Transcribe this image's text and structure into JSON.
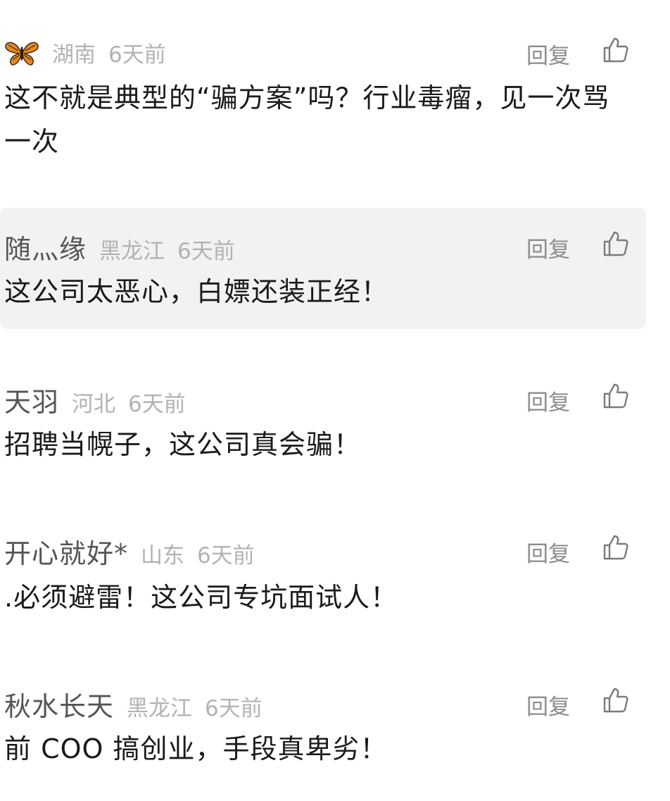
{
  "comments": [
    {
      "name": "",
      "location": "湖南",
      "time": "6天前",
      "text": "这不就是典型的“骗方案”吗？行业毒瘤，见一次骂一次",
      "reply_label": "回复",
      "avatar_icon": "butterfly-icon"
    },
    {
      "name": "随灬缘",
      "location": "黑龙江",
      "time": "6天前",
      "text": "这公司太恶心，白嫖还装正经！",
      "reply_label": "回复"
    },
    {
      "name": "天羽",
      "location": "河北",
      "time": "6天前",
      "text": "招聘当幌子，这公司真会骗！",
      "reply_label": "回复"
    },
    {
      "name": "开心就好*",
      "location": "山东",
      "time": "6天前",
      "text": ".必须避雷！这公司专坑面试人！",
      "reply_label": "回复"
    },
    {
      "name": "秋水长天",
      "location": "黑龙江",
      "time": "6天前",
      "text": "前 COO 搞创业，手段真卑劣！",
      "reply_label": "回复"
    }
  ],
  "colors": {
    "highlight_bg": "#f2f2f2",
    "name": "#555555",
    "meta": "#b3b3b3",
    "text": "#1a1a1a"
  }
}
